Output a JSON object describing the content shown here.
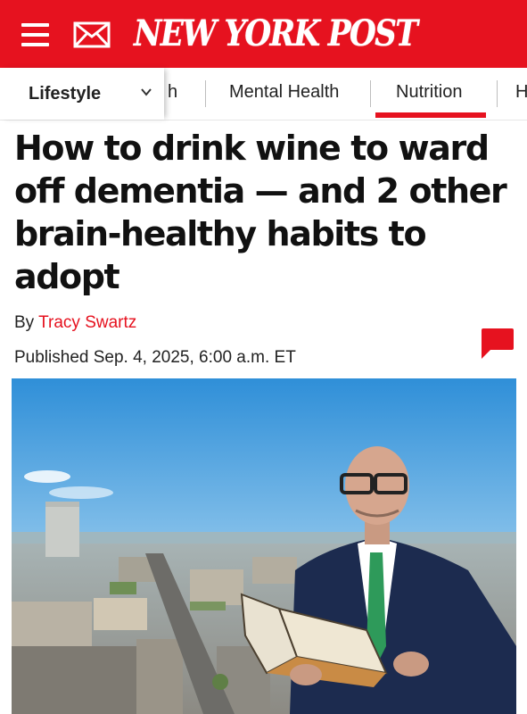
{
  "header": {
    "logo_text": "NEW YORK POST",
    "brand_color": "#e6121f",
    "menu_icon": "hamburger-icon",
    "mail_icon": "mail-icon"
  },
  "subnav": {
    "section_label": "Lifestyle",
    "section_chevron": "⌄",
    "tabs": [
      {
        "label": "h"
      },
      {
        "label": "Mental Health"
      },
      {
        "label": "Nutrition",
        "active": true
      },
      {
        "label": "H"
      }
    ]
  },
  "article": {
    "headline": "How to drink wine to ward off dementia — and 2 other brain-healthy habits to adopt",
    "byline_prefix": "By",
    "author": "Tracy Swartz",
    "published": "Published Sep. 4, 2025, 6:00 a.m. ET",
    "comment_icon": "comment-icon"
  }
}
